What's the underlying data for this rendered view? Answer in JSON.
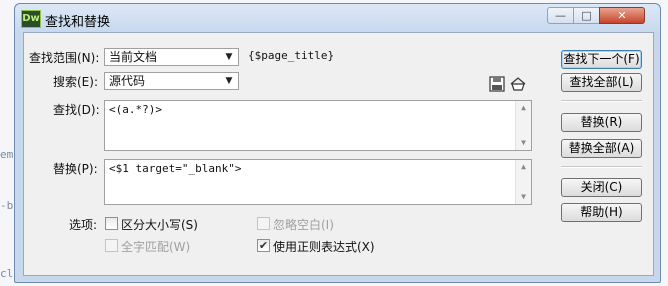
{
  "background": {
    "fragments": [
      "em",
      "-b",
      "cl"
    ]
  },
  "window": {
    "title": "查找和替换",
    "app_icon_text": "Dw",
    "controls": {
      "minimize": "—",
      "maximize": "□",
      "close": "✕"
    }
  },
  "form": {
    "scope_label": "查找范围(N):",
    "scope_value": "当前文档",
    "scope_extra": "{$page_title}",
    "search_label": "搜索(E):",
    "search_value": "源代码",
    "find_label": "查找(D):",
    "find_value": "<(a.*?)>",
    "replace_label": "替换(P):",
    "replace_value": "<$1 target=\"_blank\">",
    "options_label": "选项:"
  },
  "options": {
    "match_case": {
      "label": "区分大小写(S)",
      "checked": false,
      "enabled": true
    },
    "whole_word": {
      "label": "全字匹配(W)",
      "checked": false,
      "enabled": false
    },
    "ignore_whitespace": {
      "label": "忽略空白(I)",
      "checked": false,
      "enabled": false
    },
    "use_regex": {
      "label": "使用正则表达式(X)",
      "checked": true,
      "enabled": true
    }
  },
  "buttons": {
    "find_next": "查找下一个(F)",
    "find_all": "查找全部(L)",
    "replace": "替换(R)",
    "replace_all": "替换全部(A)",
    "close": "关闭(C)",
    "help": "帮助(H)"
  },
  "icons": {
    "save_query": "save-icon",
    "load_query": "open-folder-icon"
  }
}
